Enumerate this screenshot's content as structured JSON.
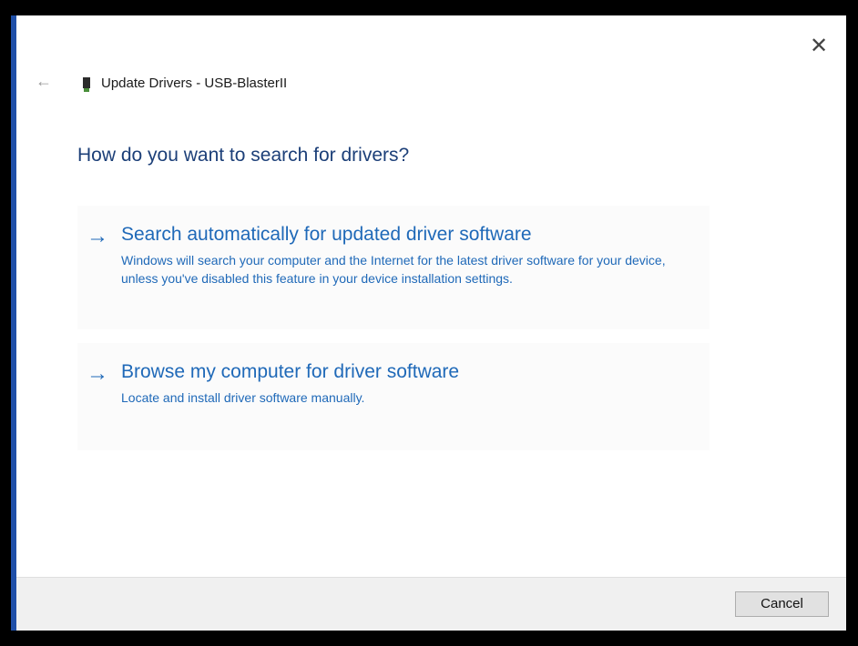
{
  "window": {
    "title": "Update Drivers - USB-BlasterII",
    "close_glyph": "✕",
    "back_glyph": "←",
    "device_icon": "usb-device-icon"
  },
  "main": {
    "heading": "How do you want to search for drivers?",
    "options": [
      {
        "arrow": "→",
        "title": "Search automatically for updated driver software",
        "description": "Windows will search your computer and the Internet for the latest driver software for your device, unless you've disabled this feature in your device installation settings."
      },
      {
        "arrow": "→",
        "title": "Browse my computer for driver software",
        "description": "Locate and install driver software manually."
      }
    ]
  },
  "footer": {
    "cancel_label": "Cancel"
  },
  "colors": {
    "link_blue": "#1f69b8",
    "heading_blue": "#1c3f78",
    "footer_bg": "#f0f0f0"
  }
}
